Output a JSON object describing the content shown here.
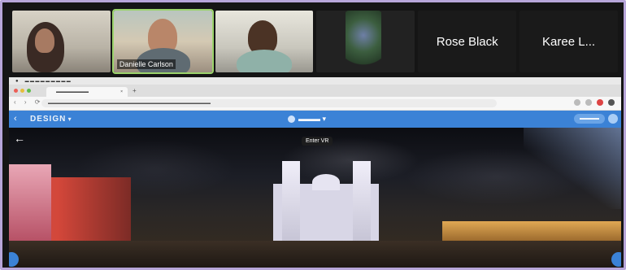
{
  "call": {
    "participants": [
      {
        "name": "",
        "kind": "video"
      },
      {
        "name": "Danielle Carlson",
        "kind": "video"
      },
      {
        "name": "",
        "kind": "video"
      },
      {
        "name": "",
        "kind": "video"
      },
      {
        "name": "Rose Black",
        "kind": "name-only"
      },
      {
        "name": "Karee L...",
        "kind": "name-only"
      }
    ]
  },
  "app": {
    "title": "DESIGN",
    "vr_tooltip": "Enter VR"
  },
  "colors": {
    "frame_border": "#b7a6d9",
    "app_blue": "#3b82d6",
    "speaker_outline": "#9bd36b"
  },
  "icons": {
    "back": "arrow-left-icon",
    "tab_close": "close-icon",
    "new_tab": "plus-icon"
  }
}
